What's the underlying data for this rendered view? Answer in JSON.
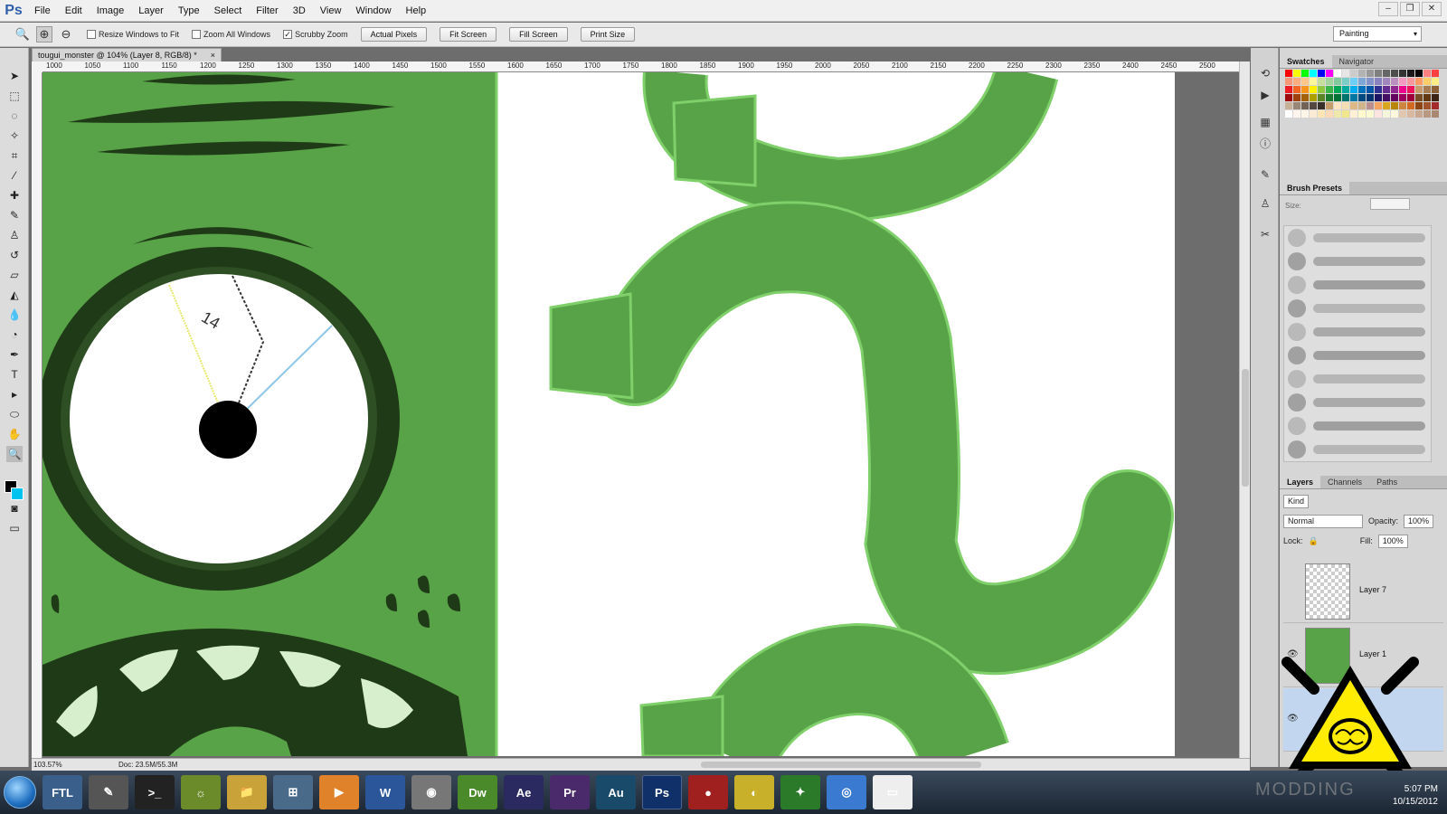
{
  "app": {
    "logo": "Ps"
  },
  "menu": [
    "File",
    "Edit",
    "Image",
    "Layer",
    "Type",
    "Select",
    "Filter",
    "3D",
    "View",
    "Window",
    "Help"
  ],
  "window_controls": [
    "–",
    "❐",
    "✕"
  ],
  "options": {
    "resize_windows": "Resize Windows to Fit",
    "zoom_all": "Zoom All Windows",
    "scrubby": "Scrubby Zoom",
    "scrubby_checked": "✓",
    "actual_pixels": "Actual Pixels",
    "fit_screen": "Fit Screen",
    "fill_screen": "Fill Screen",
    "print_size": "Print Size",
    "workspace": "Painting"
  },
  "document": {
    "tab_title": "tougui_monster @ 104% (Layer 8, RGB/8) *",
    "close": "×",
    "zoom": "103.57%",
    "doc_size": "Doc: 23.5M/55.3M",
    "ruler_ticks": [
      "1000",
      "1050",
      "1100",
      "1150",
      "1200",
      "1250",
      "1300",
      "1350",
      "1400",
      "1450",
      "1500",
      "1550",
      "1600",
      "1650",
      "1700",
      "1750",
      "1800",
      "1850",
      "1900",
      "1950",
      "2000",
      "2050",
      "2100",
      "2150",
      "2200",
      "2250",
      "2300",
      "2350",
      "2400",
      "2450",
      "2500"
    ],
    "eye_number": "14"
  },
  "panels": {
    "swatches_tab": "Swatches",
    "navigator_tab": "Navigator",
    "brush_tab": "Brush Presets",
    "brush_size_label": "Size:",
    "layers_tab": "Layers",
    "channels_tab": "Channels",
    "paths_tab": "Paths",
    "kind": "Kind",
    "blend_mode": "Normal",
    "opacity_label": "Opacity:",
    "opacity": "100%",
    "lock_label": "Lock:",
    "fill_label": "Fill:",
    "fill": "100%",
    "layers": [
      {
        "name": "Layer 7"
      },
      {
        "name": "Layer 1"
      }
    ]
  },
  "swatch_colors": [
    "#ff0000",
    "#ffff00",
    "#00ff00",
    "#00ffff",
    "#0000ff",
    "#ff00ff",
    "#ffffff",
    "#e6e6e6",
    "#cccccc",
    "#b3b3b3",
    "#999999",
    "#808080",
    "#666666",
    "#4d4d4d",
    "#333333",
    "#1a1a1a",
    "#000000",
    "#ff8080",
    "#ff4040",
    "#f7977a",
    "#f9ad81",
    "#fdc68a",
    "#fff79a",
    "#c4df9b",
    "#a2d39c",
    "#82ca9d",
    "#7bcdc8",
    "#6ecff6",
    "#7ea7d8",
    "#8493ca",
    "#8882be",
    "#a187be",
    "#bc8dbf",
    "#f49ac2",
    "#f6989d",
    "#ff9966",
    "#ffcc66",
    "#ffee88",
    "#ed1c24",
    "#f26522",
    "#f7941d",
    "#fff200",
    "#8dc63f",
    "#39b54a",
    "#00a651",
    "#00a99d",
    "#00aeef",
    "#0072bc",
    "#0054a6",
    "#2e3192",
    "#662d91",
    "#92278f",
    "#ec008c",
    "#ed145b",
    "#c69c6d",
    "#a67c52",
    "#8c6239",
    "#9e0b0f",
    "#a0410d",
    "#a3620a",
    "#aba000",
    "#598527",
    "#197b30",
    "#007236",
    "#00746b",
    "#0076a3",
    "#004a80",
    "#003471",
    "#1b1464",
    "#440e62",
    "#630460",
    "#9e005d",
    "#9e0039",
    "#754c24",
    "#603913",
    "#3c2415",
    "#c7b299",
    "#998675",
    "#736357",
    "#534741",
    "#37302a",
    "#c69c6d",
    "#ffe4c4",
    "#f5deb3",
    "#deb887",
    "#d2b48c",
    "#bc8f8f",
    "#f4a460",
    "#daa520",
    "#b8860b",
    "#cd853f",
    "#d2691e",
    "#8b4513",
    "#a0522d",
    "#a52a2a",
    "#ffffff",
    "#fff5ee",
    "#fdf5e6",
    "#faebd7",
    "#ffe4b5",
    "#ffdab9",
    "#eee8aa",
    "#f0e68c",
    "#ffefd5",
    "#fffacd",
    "#fafad2",
    "#ffe4e1",
    "#f5f5dc",
    "#fff8dc",
    "#e0c8b0",
    "#d8b8a0",
    "#c8a890",
    "#b89880",
    "#a88870"
  ],
  "taskbar": {
    "apps": [
      "FTL",
      "✎",
      ">_",
      "☼",
      "📁",
      "⊞",
      "▶",
      "W",
      "◉",
      "Dw",
      "Ae",
      "Pr",
      "Au",
      "Ps",
      "●",
      "◐",
      "✦",
      "◎",
      "▭"
    ],
    "time": "5:07 PM",
    "date": "10/15/2012"
  },
  "watermark": "MODDING",
  "colors": {
    "monster_green": "#58a347",
    "monster_dark": "#1f3a17",
    "tooth": "#d7efcc",
    "accent_fg": "#000000",
    "accent_bg": "#00c4f0"
  }
}
